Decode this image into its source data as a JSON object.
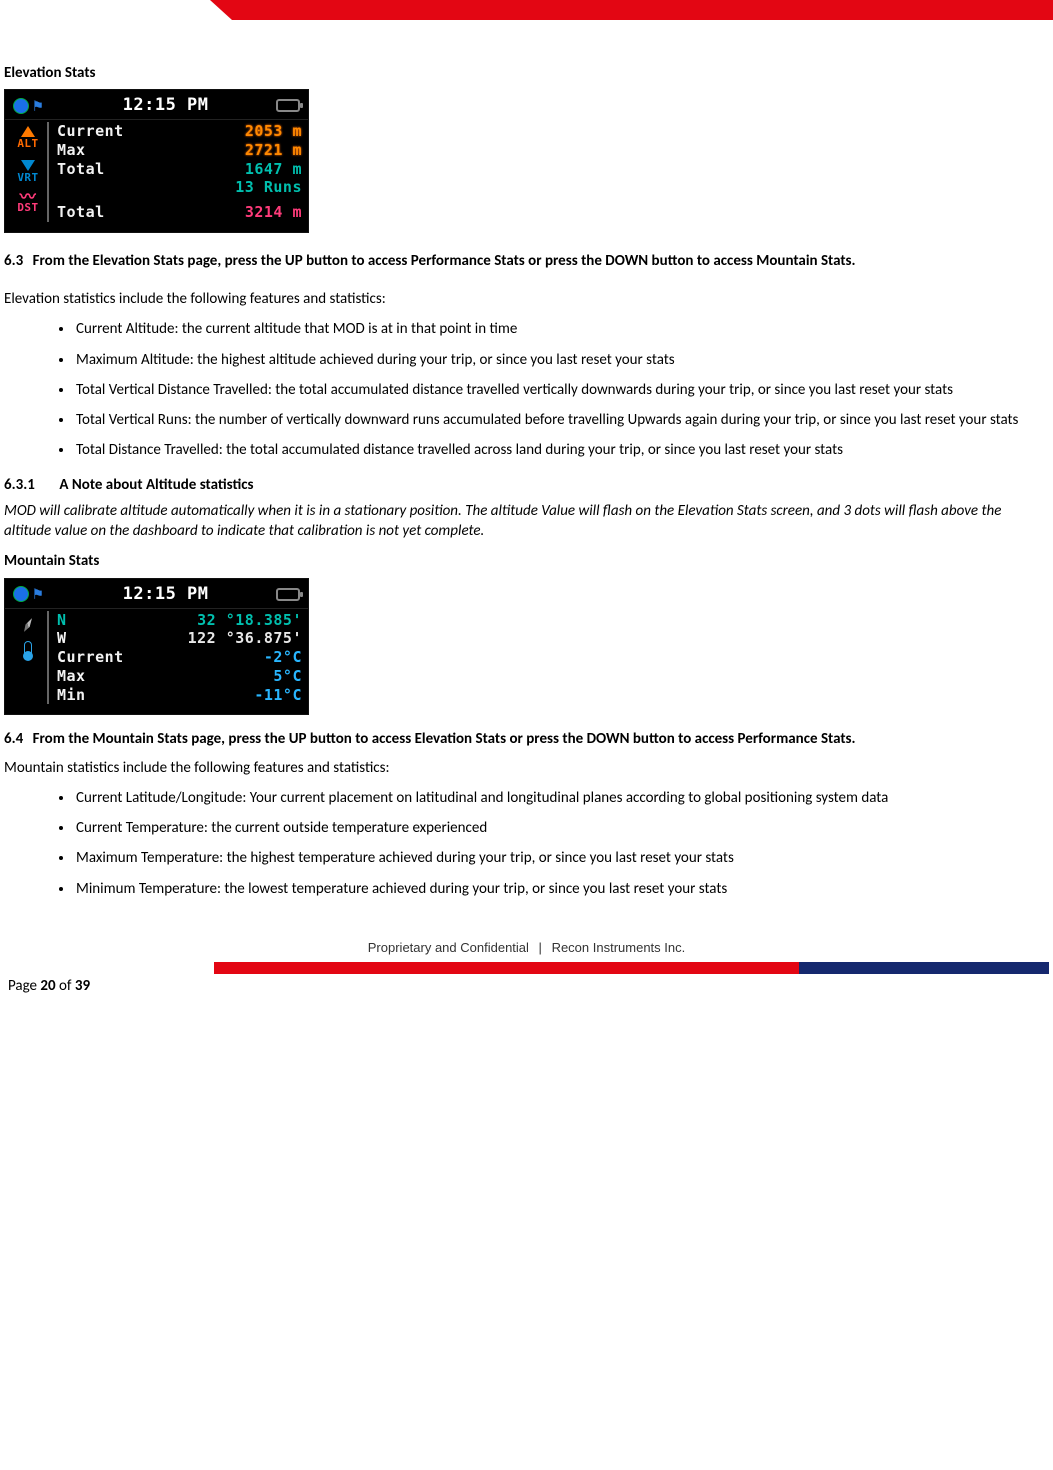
{
  "headings": {
    "elevation_stats": "Elevation Stats",
    "mountain_stats": "Mountain Stats"
  },
  "section_6_3": {
    "num": "6.3",
    "text": "From the Elevation Stats page, press the UP button to access Performance Stats or press the DOWN button to access Mountain Stats.",
    "intro": "Elevation statistics include the following features and statistics:",
    "bullets": [
      "Current Altitude: the current altitude that MOD is at in that point in time",
      "Maximum Altitude: the highest altitude achieved during your trip, or since you last reset your stats",
      "Total Vertical Distance Travelled: the total accumulated distance travelled vertically downwards during your trip, or since you last reset your stats",
      "Total Vertical Runs: the number of vertically downward runs accumulated before travelling Upwards again during your trip, or since you last reset your stats",
      "Total Distance Travelled: the total accumulated distance travelled across land during your trip, or since you last reset your stats"
    ]
  },
  "section_6_3_1": {
    "num": "6.3.1",
    "title": "A Note about Altitude statistics",
    "body": "MOD will calibrate altitude automatically when it is in a stationary position. The altitude Value will flash on the Elevation Stats screen, and 3 dots will flash above the altitude value on the dashboard to indicate that calibration is not yet complete."
  },
  "section_6_4": {
    "num": "6.4",
    "text": "From the Mountain Stats page, press the UP button to access Elevation Stats or press the DOWN button to access Performance Stats.",
    "intro": "Mountain statistics include the following features and statistics:",
    "bullets": [
      "Current Latitude/Longitude: Your current placement on latitudinal and longitudinal planes according to global positioning system data",
      "Current Temperature: the current outside temperature experienced",
      "Maximum Temperature: the highest temperature achieved during your trip, or since you last reset your stats",
      "Minimum Temperature: the lowest temperature achieved during your trip, or since you last reset your stats"
    ]
  },
  "device1": {
    "time": "12:15 PM",
    "alt_label": "ALT",
    "vrt_label": "VRT",
    "dst_label": "DST",
    "rows": {
      "current_l": "Current",
      "current_v": "2053 m",
      "max_l": "Max",
      "max_v": "2721 m",
      "total_l": "Total",
      "total_v": "1647 m",
      "runs_v": "13 Runs",
      "dst_total_l": "Total",
      "dst_total_v": "3214 m"
    }
  },
  "device2": {
    "time": "12:15 PM",
    "rows": {
      "n_l": "N",
      "n_v": "32 °18.385'",
      "w_l": "W",
      "w_v": "122 °36.875'",
      "cur_l": "Current",
      "cur_v": "-2°C",
      "max_l": "Max",
      "max_v": "5°C",
      "min_l": "Min",
      "min_v": "-11°C"
    }
  },
  "footer": {
    "proprietary": "Proprietary and Confidential",
    "sep": "|",
    "company": "Recon Instruments Inc.",
    "page_pre": "Page ",
    "page_cur": "20",
    "page_mid": " of ",
    "page_tot": "39"
  }
}
